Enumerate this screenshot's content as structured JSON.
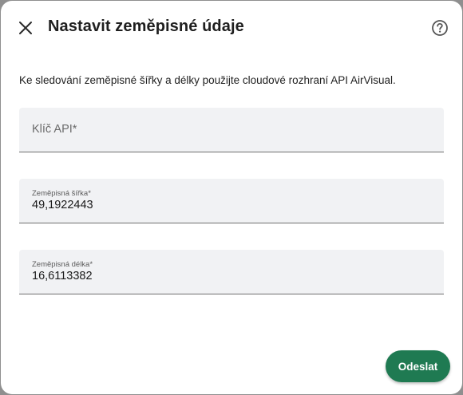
{
  "dialog": {
    "title": "Nastavit zeměpisné údaje",
    "description": "Ke sledování zeměpisné šířky a délky použijte cloudové rozhraní API AirVisual.",
    "close_icon": "close-icon",
    "help_icon": "help-circle-icon"
  },
  "fields": {
    "api_key": {
      "placeholder": "Klíč API*",
      "value": ""
    },
    "latitude": {
      "label": "Zeměpisná šířka*",
      "value": "49,1922443"
    },
    "longitude": {
      "label": "Zeměpisná délka*",
      "value": "16,6113382"
    }
  },
  "actions": {
    "submit_label": "Odeslat"
  },
  "colors": {
    "accent": "#1f7a52",
    "field_background": "#f1f2f4",
    "backdrop": "#8f8f8f"
  }
}
